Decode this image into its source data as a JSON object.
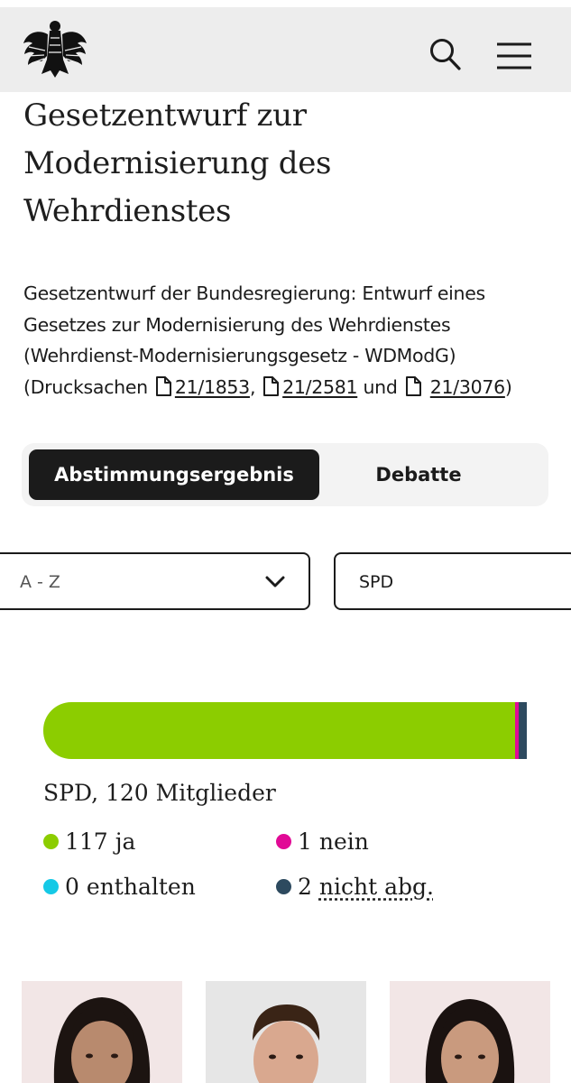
{
  "header": {
    "logo_icon": "bundestag-eagle-icon",
    "search_icon": "search-icon",
    "menu_icon": "hamburger-menu-icon"
  },
  "page": {
    "title": "Gesetzentwurf zur Modernisierung des Wehrdienstes",
    "description_text": "Gesetzentwurf der Bundesregierung: Entwurf eines Gesetzes zur Modernisierung des Wehrdienstes (Wehrdienst-Modernisierungsgesetz - WDModG)",
    "drucksachen_prefix": "(Drucksachen",
    "documents": [
      "21/1853",
      "21/2581",
      "21/3076"
    ],
    "sep_comma": ",",
    "sep_und": "und",
    "suffix": ")"
  },
  "tabs": {
    "active": "Abstimmungsergebnis",
    "inactive": "Debatte"
  },
  "filters": {
    "sort_value": "A - Z",
    "party_value": "SPD"
  },
  "result": {
    "party_summary": "SPD, 120 Mitglieder",
    "ja": {
      "count": "117",
      "label": "ja",
      "value": 117,
      "color": "#8ccd00"
    },
    "nein": {
      "count": "1",
      "label": "nein",
      "value": 1,
      "color": "#e10a96"
    },
    "enthalten": {
      "count": "0",
      "label": "enthalten",
      "value": 0,
      "color": "#15c9e6"
    },
    "nicht_abg": {
      "count": "2",
      "label": "nicht abg.",
      "value": 2,
      "color": "#2d4a5f"
    },
    "total": 120
  },
  "members": [
    {
      "photo": "member-photo-1",
      "bg": "#f2e6e6"
    },
    {
      "photo": "member-photo-2",
      "bg": "#e6e6e6"
    },
    {
      "photo": "member-photo-3",
      "bg": "#f2e6e6"
    }
  ]
}
